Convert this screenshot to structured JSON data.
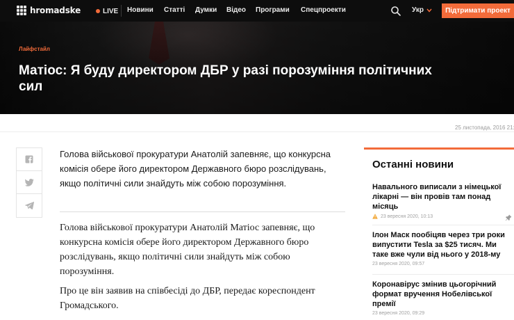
{
  "brand": {
    "name": "hromadske"
  },
  "nav": {
    "live_label": "LIVE",
    "items": [
      "Новини",
      "Статті",
      "Думки",
      "Відео",
      "Програми",
      "Спецпроекти"
    ],
    "language": "Укр",
    "support_button": "Підтримати проект"
  },
  "article": {
    "category": "Лайфстайл",
    "title": "Матіос: Я буду директором ДБР у разі порозуміння політичних сил",
    "date": "25 листопада, 2016 21:",
    "lead": "Голова військової прокуратури Анатолій запевняє, що конкурсна комісія обере його директором Державного бюро розслідувань, якщо політичні сили знайдуть між собою порозуміння.",
    "paragraphs": [
      "Голова військової прокуратури Анатолій Матіос запевняє, що конкурсна комісія обере його директором Державного бюро розслідувань, якщо політичні сили знайдуть між собою порозуміння.",
      "Про це він заявив на співбесіді до ДБР, передає кореспондент Громадського."
    ]
  },
  "share": {
    "icons": [
      "facebook-icon",
      "twitter-icon",
      "telegram-icon"
    ]
  },
  "latest_news": {
    "heading": "Останні новини",
    "items": [
      {
        "title": "Навального виписали з німецької лікарні — він провів там понад місяць",
        "date": "23 вересня 2020, 10:13"
      },
      {
        "title": "Ілон Маск пообіцяв через три роки випустити Tesla за $25 тисяч. Ми таке вже чули від нього у 2018-му",
        "date": "23 вересня 2020, 09:57"
      },
      {
        "title": "Коронавірус змінив цьогорічний формат вручення Нобелівської премії",
        "date": "23 вересня 2020, 09:29"
      }
    ]
  },
  "colors": {
    "accent": "#f26b3a",
    "nav_bg": "#0d0d0d",
    "text": "#1a1a1a",
    "muted": "#9a9a9a"
  }
}
